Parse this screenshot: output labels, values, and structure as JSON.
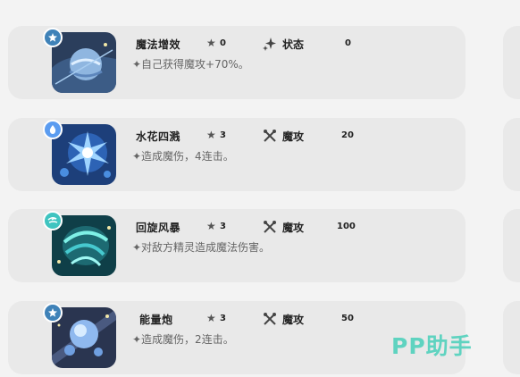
{
  "skills": [
    {
      "name": "魔法增效",
      "star_icon": "star-icon",
      "stars": "0",
      "type_icon": "sparkle-icon",
      "type": "状态",
      "power": "0",
      "description": "✦自己获得魔攻+70%。",
      "badge_color": "#3f82b8",
      "badge_icon": "star-badge-icon"
    },
    {
      "name": "水花四溅",
      "star_icon": "star-icon",
      "stars": "3",
      "type_icon": "crossed-wands-icon",
      "type": "魔攻",
      "power": "20",
      "description": "✦造成魔伤，4连击。",
      "badge_color": "#5b9cf0",
      "badge_icon": "water-drop-icon"
    },
    {
      "name": "回旋风暴",
      "star_icon": "star-icon",
      "stars": "3",
      "type_icon": "crossed-wands-icon",
      "type": "魔攻",
      "power": "100",
      "description": "✦对敌方精灵造成魔法伤害。",
      "badge_color": "#3fc4c0",
      "badge_icon": "wind-icon"
    },
    {
      "name": "能量炮",
      "star_icon": "star-icon",
      "stars": "3",
      "type_icon": "crossed-wands-icon",
      "type": "魔攻",
      "power": "50",
      "description": "✦造成魔伤，2连击。",
      "badge_color": "#3f82b8",
      "badge_icon": "star-badge-icon"
    }
  ],
  "watermark": "PP助手"
}
